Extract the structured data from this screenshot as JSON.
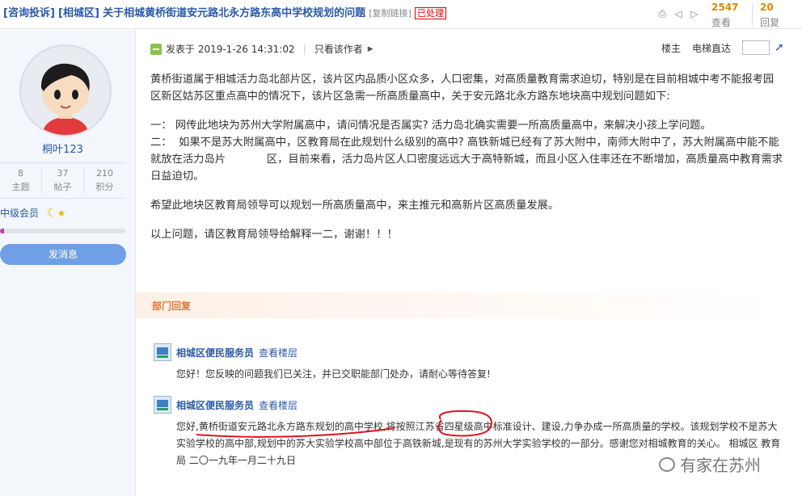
{
  "title": {
    "tag1": "[咨询投诉]",
    "tag2": "[相城区]",
    "main": "关于相城黄桥街道安元路北永方路东高中学校规划的问题",
    "copy_link": "[复制链接]",
    "status": "已处理"
  },
  "counts": {
    "views": "2547",
    "views_label": "查看",
    "replies": "20",
    "replies_label": "回复"
  },
  "user": {
    "name": "桐叶123",
    "topics": "8",
    "topics_label": "主题",
    "posts": "37",
    "posts_label": "帖子",
    "points": "210",
    "points_label": "积分",
    "level": "中级会员",
    "message_button": "发消息"
  },
  "post_meta": {
    "posted": "发表于 2019-1-26 14:31:02",
    "author_only": "只看该作者",
    "floor_owner": "楼主",
    "jump_label": "电梯直达"
  },
  "post": {
    "p1": "黄桥街道属于相城活力岛北部片区，该片区内品质小区众多，人口密集，对高质量教育需求迫切，特别是在目前相城中考不能报考园区新区姑苏区重点高中的情况下，该片区急需一所高质量高中，关于安元路北永方路东地块高中规划问题如下:",
    "q1": "一：  网传此地块为苏州大学附属高中，请问情况是否属实? 活力岛北确实需要一所高质量高中，来解决小孩上学问题。",
    "q2": "二：  如果不是苏大附属高中，区教育局在此规划什么级别的高中? 高铁新城已经有了苏大附中，南师大附中了，苏大附属高中能不能就放在活力岛片            区，目前来看，活力岛片区人口密度远远大于高特新城，而且小区入住率还在不断增加，高质量高中教育需求日益迫切。",
    "p3": "希望此地块区教育局领导可以规划一所高质量高中，来主推元和高新片区高质量发展。",
    "p4": "以上问题，请区教育局领导给解释一二，谢谢！！！"
  },
  "dept": {
    "label": "部门回复"
  },
  "reply1": {
    "author": "相城区便民服务员",
    "floor": "查看楼层",
    "text": "您好！您反映的问题我们已关注，并已交职能部门处办，请耐心等待答复!"
  },
  "reply2": {
    "author": "相城区便民服务员",
    "floor": "查看楼层",
    "text": "您好,黄桥街道安元路北永方路东规划的高中学校,将按照江苏省四星级高中标准设计、建设,力争办成一所高质量的学校。该规划学校不是苏大实验学校的高中部,规划中的苏大实验学校高中部位于高铁新城,是现有的苏州大学实验学校的一部分。感谢您对相城教育的关心。 相城区 教育局 二〇一九年一月二十九日"
  },
  "watermark": "有家在苏州",
  "colors": {
    "link": "#2b5aa8",
    "accent": "#d88a00",
    "dept": "#e07b3a",
    "annotation": "#e0141e"
  }
}
